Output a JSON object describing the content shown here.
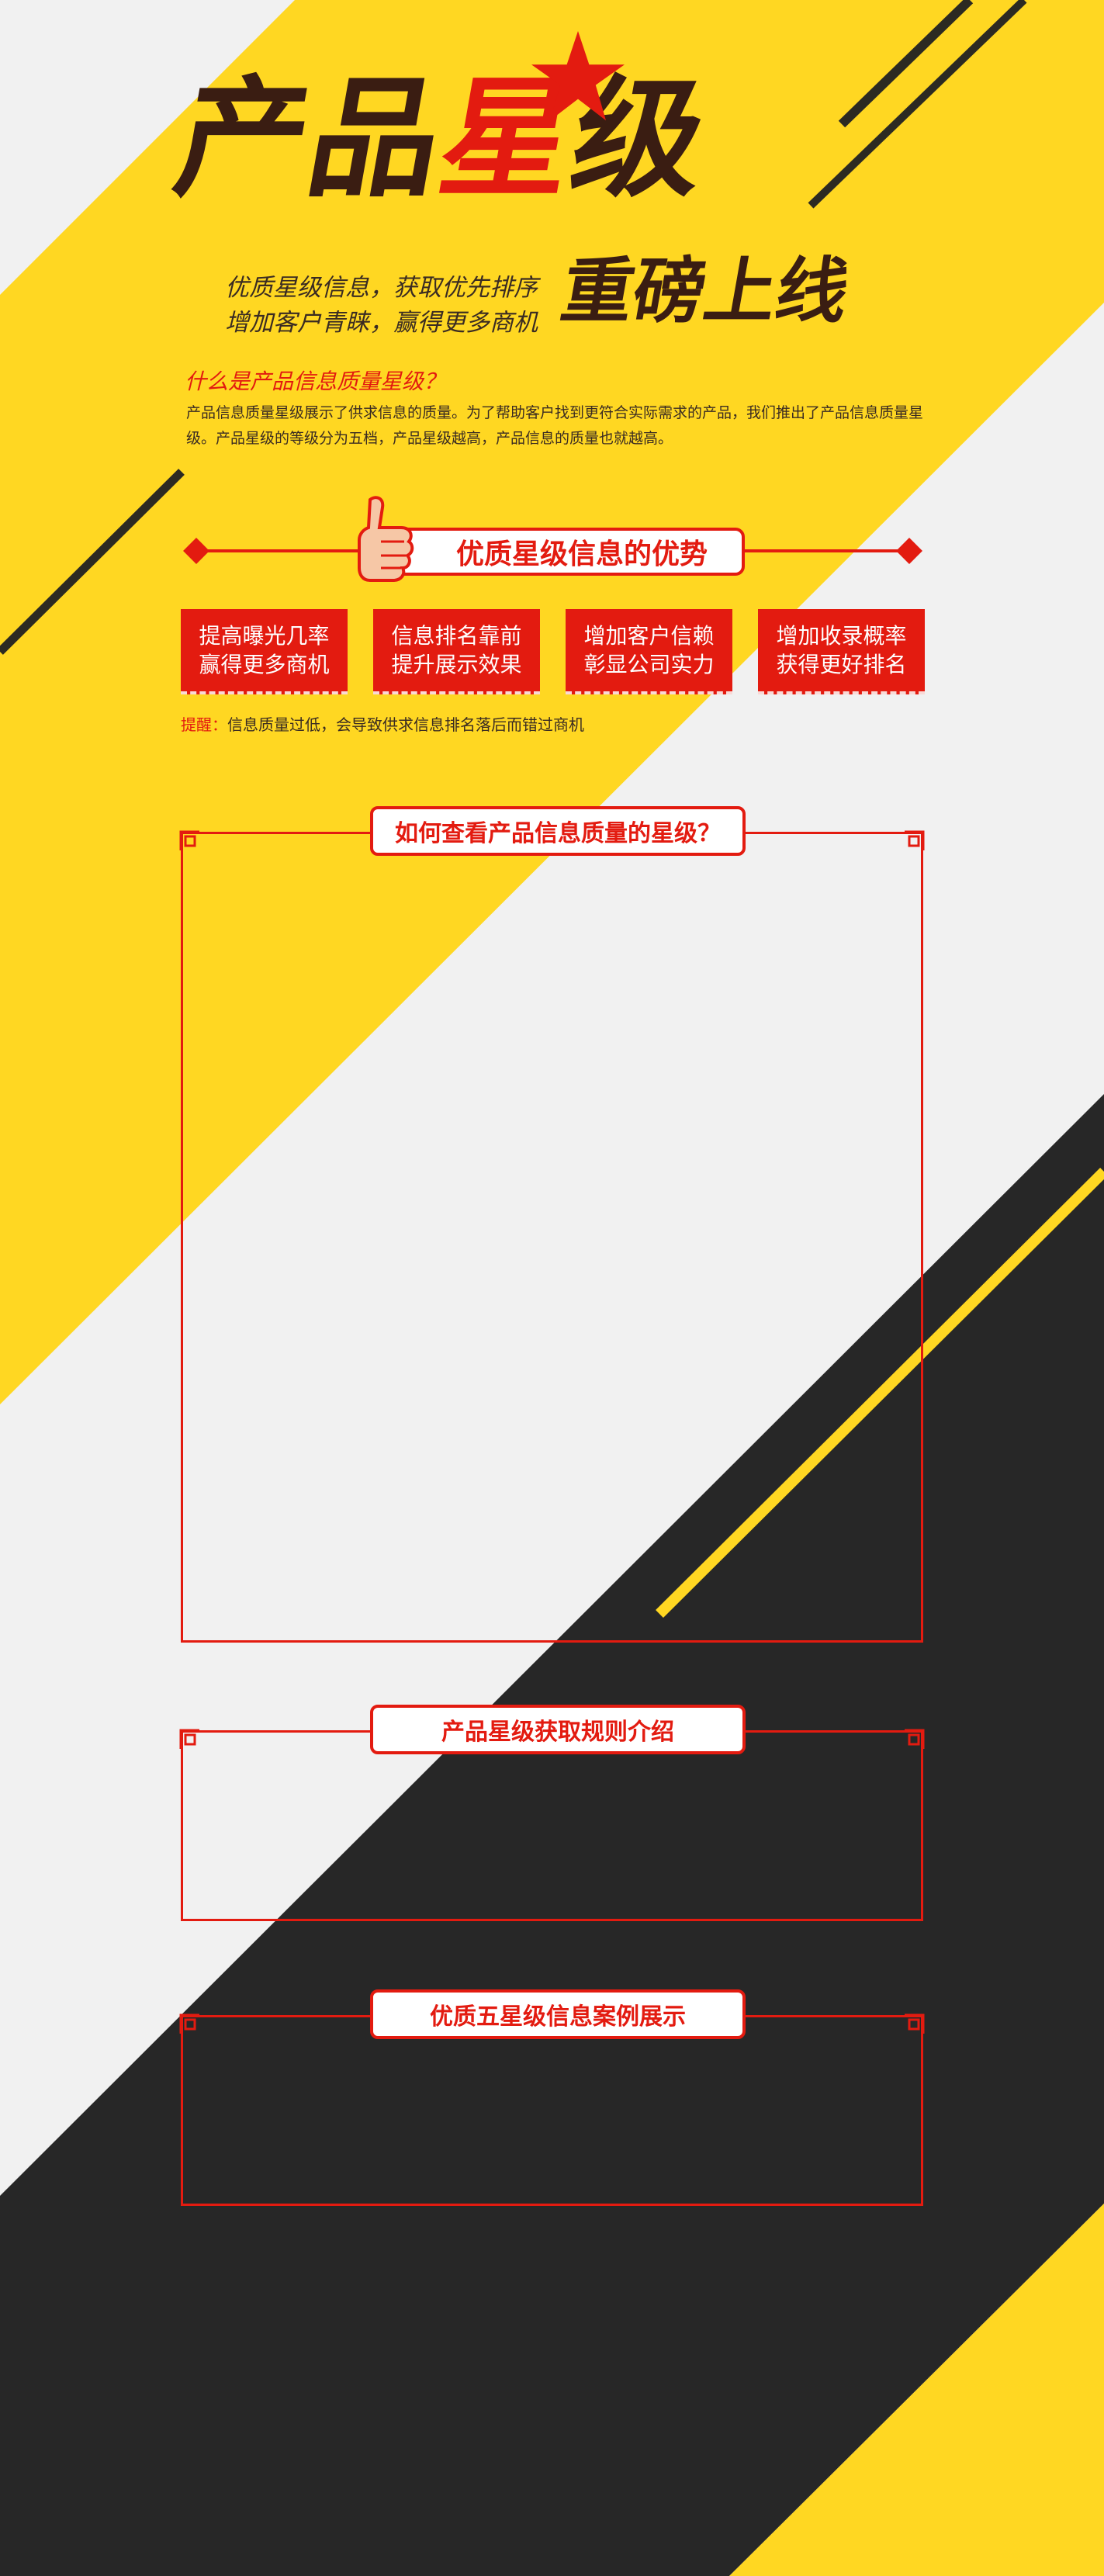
{
  "header": {
    "title_part1": "产品",
    "title_highlight": "星",
    "title_part2": "级",
    "tagline_1": "优质星级信息，获取优先排序",
    "tagline_2": "增加客户青睐，赢得更多商机",
    "launch_text": "重磅上线"
  },
  "intro": {
    "heading": "什么是产品信息质量星级？",
    "body": "产品信息质量星级展示了供求信息的质量。为了帮助客户找到更符合实际需求的产品，我们推出了产品信息质量星级。产品星级的等级分为五档，产品星级越高，产品信息的质量也就越高。"
  },
  "advantages": {
    "title": "优质星级信息的优势",
    "cards": [
      {
        "line1": "提高曝光几率",
        "line2": "赢得更多商机"
      },
      {
        "line1": "信息排名靠前",
        "line2": "提升展示效果"
      },
      {
        "line1": "增加客户信赖",
        "line2": "彰显公司实力"
      },
      {
        "line1": "增加收录概率",
        "line2": "获得更好排名"
      }
    ],
    "tip_label": "提醒：",
    "tip_text": "信息质量过低，会导致供求信息排名落后而错过商机"
  },
  "sections": [
    {
      "title": "如何查看产品信息质量的星级？"
    },
    {
      "title": "产品星级获取规则介绍"
    },
    {
      "title": "优质五星级信息案例展示"
    }
  ],
  "colors": {
    "yellow": "#ffd722",
    "red": "#e31b10",
    "dark": "#272727",
    "brown": "#3a1d12",
    "light_bg": "#f1f1f1"
  },
  "icons": {
    "star": "star-icon",
    "thumbs_up": "thumbs-up-icon",
    "corner": "frame-corner-ornament"
  }
}
